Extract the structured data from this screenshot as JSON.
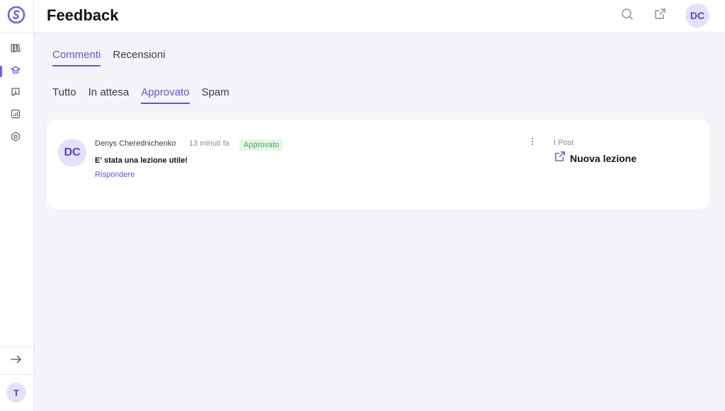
{
  "header": {
    "title": "Feedback",
    "avatar_initials": "DC",
    "icons": [
      "search-icon",
      "external-link-icon"
    ]
  },
  "sidebar": {
    "items": [
      {
        "icon": "library-icon"
      },
      {
        "icon": "graduation-cap-icon",
        "active": true
      },
      {
        "icon": "feedback-icon"
      },
      {
        "icon": "chart-icon"
      },
      {
        "icon": "settings-hex-icon"
      }
    ],
    "collapse_icon": "arrow-right-icon",
    "user_initial": "T"
  },
  "tabs": [
    {
      "label": "Commenti",
      "active": true
    },
    {
      "label": "Recensioni",
      "active": false
    }
  ],
  "filters": [
    {
      "label": "Tutto",
      "active": false
    },
    {
      "label": "In attesa",
      "active": false
    },
    {
      "label": "Approvato",
      "active": true
    },
    {
      "label": "Spam",
      "active": false
    }
  ],
  "comment": {
    "avatar_initials": "DC",
    "author": "Denys Cherednichenko",
    "time": "13 minuti fa",
    "status": "Approvato",
    "text": "E' stata una lezione utile!",
    "reply_label": "Rispondere",
    "post_label": "I Post",
    "post_title": "Nuova lezione"
  },
  "colors": {
    "accent": "#6e4fe0",
    "approved_bg": "#e5f6e9",
    "approved_text": "#3fae5a",
    "avatar_bg": "#e6e0fb"
  }
}
